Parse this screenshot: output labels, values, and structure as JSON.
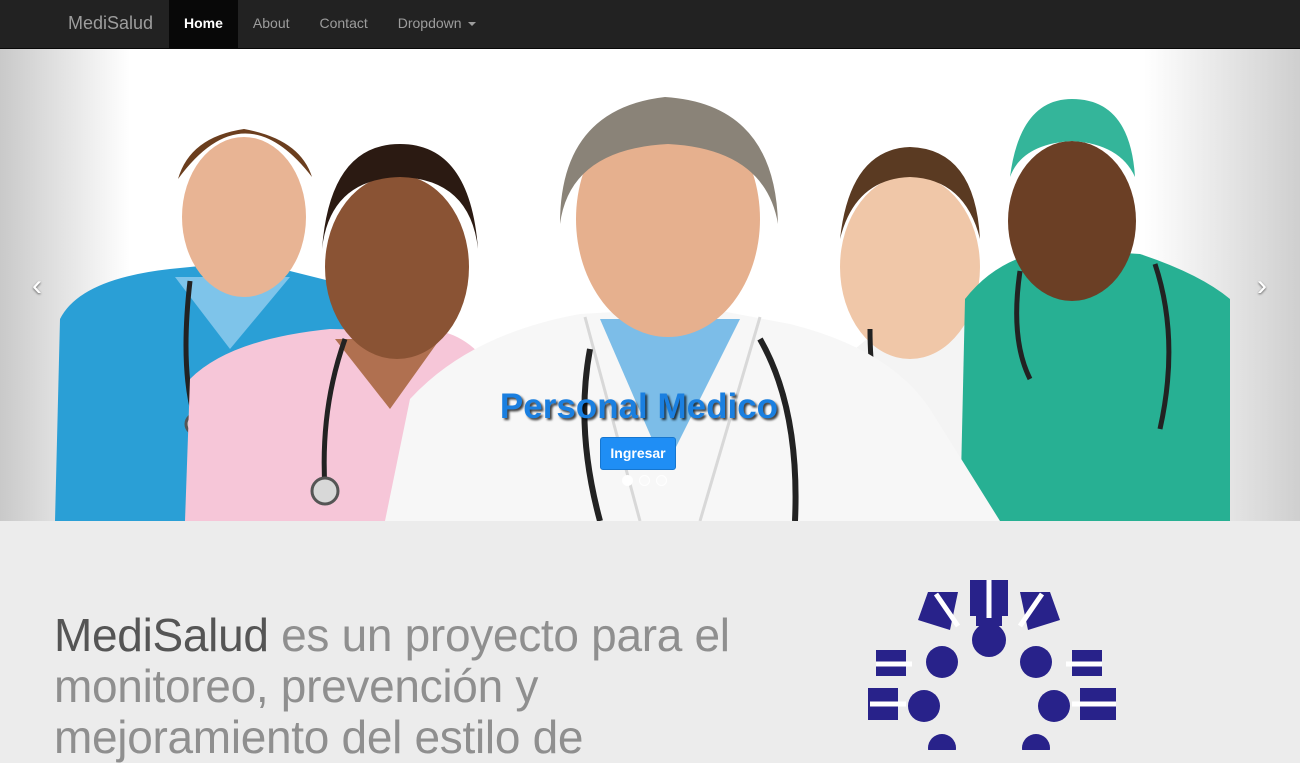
{
  "navbar": {
    "brand": "MediSalud",
    "items": [
      {
        "label": "Home",
        "active": true
      },
      {
        "label": "About",
        "active": false
      },
      {
        "label": "Contact",
        "active": false
      },
      {
        "label": "Dropdown",
        "active": false
      }
    ]
  },
  "carousel": {
    "prev_icon": "chevron-left-icon",
    "next_icon": "chevron-right-icon",
    "caption_title": "Personal Medico",
    "cta_label": "Ingresar",
    "indicator_count": 3,
    "active_index": 0,
    "image_subject": "team of medical staff in scrubs and white coats"
  },
  "featurette": {
    "heading_strong": "MediSalud",
    "heading_rest": " es un proyecto para el monitoreo, prevención y mejoramiento del estilo de"
  },
  "colors": {
    "navbar_bg": "#222222",
    "accent": "#1f8ef5",
    "logo": "#28228a",
    "page_bg": "#ececec"
  }
}
